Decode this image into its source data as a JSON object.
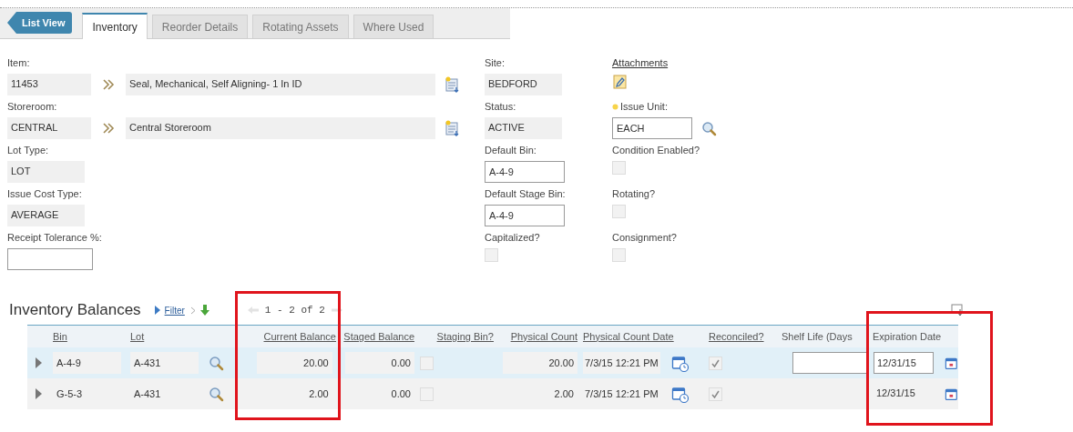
{
  "back_button": {
    "label": "List View"
  },
  "tabs": [
    {
      "label": "Inventory",
      "selected": true
    },
    {
      "label": "Reorder Details",
      "selected": false
    },
    {
      "label": "Rotating Assets",
      "selected": false
    },
    {
      "label": "Where Used",
      "selected": false
    }
  ],
  "form": {
    "left": [
      {
        "kind": "lookup",
        "label": "Item:",
        "code": "11453",
        "description": "Seal, Mechanical, Self Aligning- 1 In ID"
      },
      {
        "kind": "lookup",
        "label": "Storeroom:",
        "code": "CENTRAL",
        "description": "Central Storeroom"
      },
      {
        "kind": "readonly",
        "label": "Lot Type:",
        "value": "LOT"
      },
      {
        "kind": "readonly",
        "label": "Issue Cost Type:",
        "value": "AVERAGE"
      },
      {
        "kind": "input",
        "label": "Receipt Tolerance %:"
      }
    ],
    "middle": [
      {
        "kind": "readonly",
        "label": "Site:",
        "value": "BEDFORD"
      },
      {
        "kind": "readonly",
        "label": "Status:",
        "value": "ACTIVE"
      },
      {
        "kind": "input",
        "label": "Default Bin:",
        "value": "A-4-9"
      },
      {
        "kind": "input",
        "label": "Default Stage Bin:",
        "value": "A-4-9"
      },
      {
        "kind": "checkbox",
        "label": "Capitalized?",
        "checked": false
      }
    ],
    "right": [
      {
        "kind": "link",
        "label": "Attachments"
      },
      {
        "kind": "input",
        "label": "Issue Unit:",
        "value": "EACH",
        "required": true,
        "lookup": true
      },
      {
        "kind": "checkbox",
        "label": "Condition Enabled?",
        "checked": false
      },
      {
        "kind": "checkbox",
        "label": "Rotating?",
        "checked": false
      },
      {
        "kind": "checkbox",
        "label": "Consignment?",
        "checked": false
      }
    ]
  },
  "balances": {
    "title": "Inventory Balances",
    "filter": "Filter",
    "pager": "1 - 2 of 2",
    "columns": [
      {
        "label": "Bin",
        "highlighted": false
      },
      {
        "label": "Lot",
        "highlighted": false
      },
      {
        "label": "Current Balance",
        "highlighted": true
      },
      {
        "label": "Staged Balance",
        "highlighted": false
      },
      {
        "label": "Staging Bin?",
        "highlighted": false
      },
      {
        "label": "Physical Count",
        "highlighted": false
      },
      {
        "label": "Physical Count Date",
        "highlighted": false
      },
      {
        "label": "Reconciled?",
        "highlighted": false
      },
      {
        "label": "Shelf Life (Days",
        "highlighted": false
      },
      {
        "label": "Expiration Date",
        "highlighted": true
      }
    ],
    "rows": [
      {
        "selected": true,
        "bin": "A-4-9",
        "lot": "A-431",
        "current_balance": "20.00",
        "staged_balance": "0.00",
        "staging_bin": false,
        "physical_count": "20.00",
        "physical_count_date": "7/3/15 12:21 PM",
        "reconciled": true,
        "expiration_date": "12/31/15"
      },
      {
        "selected": false,
        "bin": "G-5-3",
        "lot": "A-431",
        "current_balance": "2.00",
        "staged_balance": "0.00",
        "staging_bin": false,
        "physical_count": "2.00",
        "physical_count_date": "7/3/15 12:21 PM",
        "reconciled": true,
        "expiration_date": "12/31/15"
      }
    ]
  }
}
